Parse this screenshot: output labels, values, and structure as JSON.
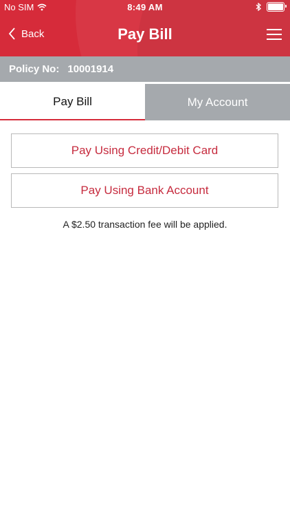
{
  "status_bar": {
    "carrier": "No SIM",
    "time": "8:49 AM",
    "icons": {
      "wifi": "wifi-icon",
      "bluetooth": "bluetooth-icon",
      "battery": "battery-icon"
    },
    "battery_level": 1.0
  },
  "nav": {
    "back_label": "Back",
    "title": "Pay Bill",
    "icons": {
      "back": "chevron-left-icon",
      "menu": "hamburger-menu-icon"
    }
  },
  "policy": {
    "label": "Policy No:",
    "number": "10001914"
  },
  "tabs": [
    {
      "label": "Pay Bill",
      "active": true
    },
    {
      "label": "My Account",
      "active": false
    }
  ],
  "payment_options": {
    "card_label": "Pay Using Credit/Debit Card",
    "bank_label": "Pay Using Bank Account"
  },
  "fee_notice": "A $2.50 transaction fee will be applied.",
  "colors": {
    "brand_red": "#d62b3a",
    "button_text": "#c62b3e",
    "gray_bar": "#a5a9ad"
  }
}
